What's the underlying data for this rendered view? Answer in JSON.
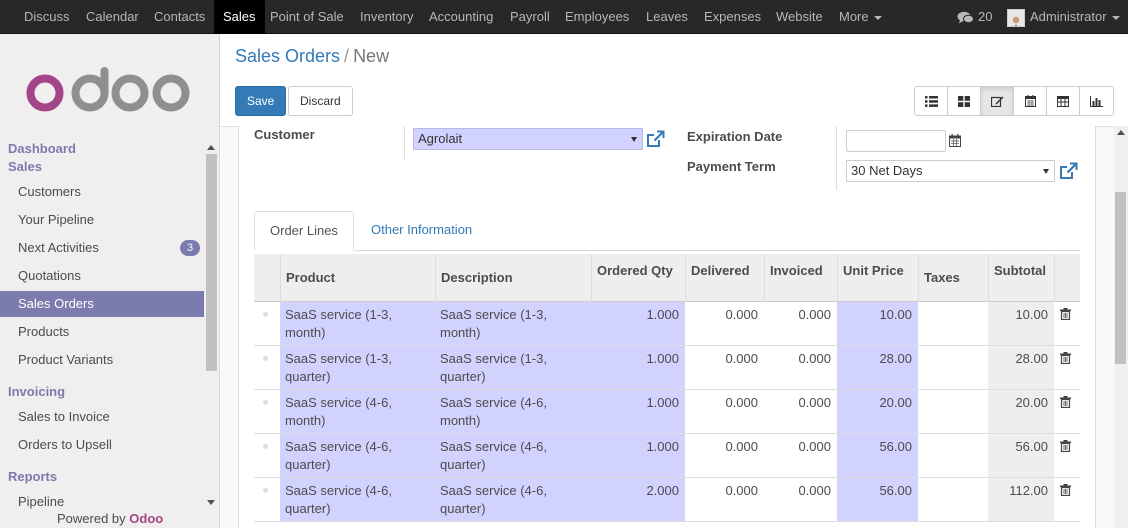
{
  "navbar": {
    "menu": [
      "Discuss",
      "Calendar",
      "Contacts",
      "Sales",
      "Point of Sale",
      "Inventory",
      "Accounting",
      "Payroll",
      "Employees",
      "Leaves",
      "Expenses",
      "Website",
      "More"
    ],
    "active": "Sales",
    "messages_count": "20",
    "user": "Administrator"
  },
  "sidebar": {
    "logo_text": "odoo",
    "sections": [
      {
        "title": "Dashboard"
      },
      {
        "title": "Sales",
        "items": [
          "Customers",
          "Your Pipeline",
          "Next Activities",
          "Quotations",
          "Sales Orders",
          "Products",
          "Product Variants"
        ]
      },
      {
        "title": "Invoicing",
        "items": [
          "Sales to Invoice",
          "Orders to Upsell"
        ]
      },
      {
        "title": "Reports",
        "items": [
          "Pipeline"
        ]
      }
    ],
    "next_activities_badge": "3",
    "active_item": "Sales Orders",
    "powered_prefix": "Powered by",
    "powered_brand": "Odoo"
  },
  "breadcrumb": {
    "parent": "Sales Orders",
    "separator": "/",
    "current": "New"
  },
  "buttons": {
    "save": "Save",
    "discard": "Discard"
  },
  "views": [
    "list-view-icon",
    "kanban-view-icon",
    "form-view-icon",
    "calendar-view-icon",
    "pivot-view-icon",
    "graph-view-icon"
  ],
  "form": {
    "customer_label": "Customer",
    "customer_value": "Agrolait",
    "expiration_label": "Expiration Date",
    "expiration_value": "",
    "payment_term_label": "Payment Term",
    "payment_term_value": "30 Net Days"
  },
  "tabs": [
    "Order Lines",
    "Other Information"
  ],
  "table": {
    "headers": [
      "Product",
      "Description",
      "Ordered Qty",
      "Delivered",
      "Invoiced",
      "Unit Price",
      "Taxes",
      "Subtotal"
    ],
    "rows": [
      {
        "product": "SaaS service (1-3, month)",
        "description": "SaaS service (1-3, month)",
        "ordered": "1.000",
        "delivered": "0.000",
        "invoiced": "0.000",
        "price": "10.00",
        "taxes": "",
        "subtotal": "10.00"
      },
      {
        "product": "SaaS service (1-3, quarter)",
        "description": "SaaS service (1-3, quarter)",
        "ordered": "1.000",
        "delivered": "0.000",
        "invoiced": "0.000",
        "price": "28.00",
        "taxes": "",
        "subtotal": "28.00"
      },
      {
        "product": "SaaS service (4-6, month)",
        "description": "SaaS service (4-6, month)",
        "ordered": "1.000",
        "delivered": "0.000",
        "invoiced": "0.000",
        "price": "20.00",
        "taxes": "",
        "subtotal": "20.00"
      },
      {
        "product": "SaaS service (4-6, quarter)",
        "description": "SaaS service (4-6, quarter)",
        "ordered": "1.000",
        "delivered": "0.000",
        "invoiced": "0.000",
        "price": "56.00",
        "taxes": "",
        "subtotal": "56.00"
      },
      {
        "product": "SaaS service (4-6, quarter)",
        "description": "SaaS service (4-6, quarter)",
        "ordered": "2.000",
        "delivered": "0.000",
        "invoiced": "0.000",
        "price": "56.00",
        "taxes": "",
        "subtotal": "112.00"
      }
    ]
  },
  "colors": {
    "brand": "#7c7bad",
    "primary": "#337ab7",
    "required": "#d2d2ff",
    "navbar": "#282828"
  }
}
